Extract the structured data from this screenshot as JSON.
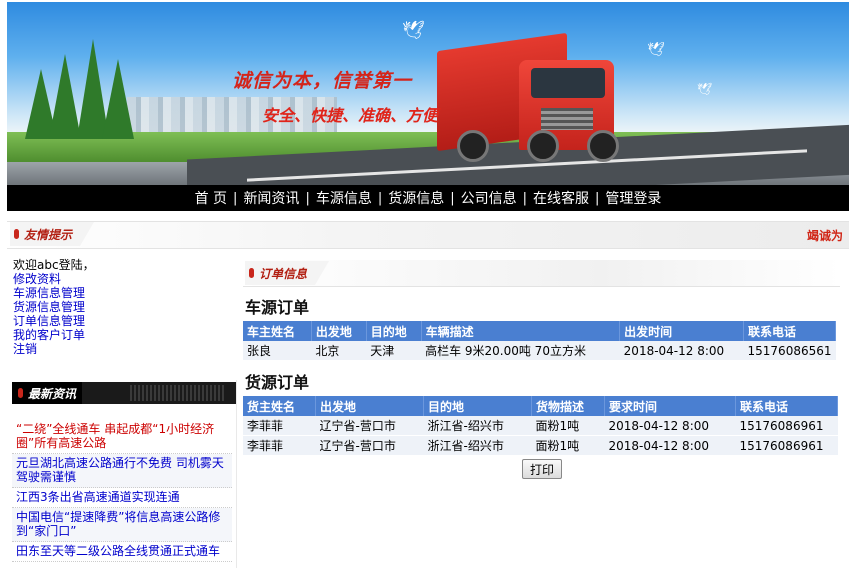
{
  "banner": {
    "slogan_main": "诚信为本，信誉第一",
    "slogan_sub": "安全、快捷、准确、方便"
  },
  "nav": {
    "items": [
      "首 页",
      "新闻资讯",
      "车源信息",
      "货源信息",
      "公司信息",
      "在线客服",
      "管理登录"
    ],
    "separator": "|"
  },
  "tip": {
    "title": "友情提示",
    "marquee": "竭诚为"
  },
  "user": {
    "greeting": "欢迎abc登陆，",
    "links": [
      "修改资料",
      "车源信息管理",
      "货源信息管理",
      "订单信息管理",
      "我的客户订单",
      "注销"
    ]
  },
  "news": {
    "title": "最新资讯",
    "items": [
      {
        "text": "“二绕”全线通车 串起成都“1小时经济圈”所有高速公路",
        "hot": true
      },
      {
        "text": "元旦湖北高速公路通行不免费 司机雾天驾驶需谨慎",
        "hot": false
      },
      {
        "text": "江西3条出省高速通道实现连通",
        "hot": false
      },
      {
        "text": "中国电信“提速降费”将信息高速公路修到“家门口”",
        "hot": false
      },
      {
        "text": "田东至天等二级公路全线贯通正式通车",
        "hot": false
      }
    ]
  },
  "orders": {
    "title": "订单信息",
    "vehicle": {
      "heading": "车源订单",
      "columns": [
        "车主姓名",
        "出发地",
        "目的地",
        "车辆描述",
        "出发时间",
        "联系电话"
      ],
      "rows": [
        [
          "张良",
          "北京",
          "天津",
          "高栏车 9米20.00吨 70立方米",
          "2018-04-12 8:00",
          "15176086561"
        ]
      ]
    },
    "cargo": {
      "heading": "货源订单",
      "columns": [
        "货主姓名",
        "出发地",
        "目的地",
        "货物描述",
        "要求时间",
        "联系电话"
      ],
      "rows": [
        [
          "李菲菲",
          "辽宁省-营口市",
          "浙江省-绍兴市",
          "面粉1吨",
          "2018-04-12 8:00",
          "15176086961"
        ],
        [
          "李菲菲",
          "辽宁省-营口市",
          "浙江省-绍兴市",
          "面粉1吨",
          "2018-04-12 8:00",
          "15176086961"
        ]
      ]
    },
    "print_label": "打印"
  },
  "colors": {
    "nav_bg": "#000000",
    "table_header": "#4a7fd1",
    "accent_red": "#c8261b",
    "link_blue": "#0000cc"
  }
}
